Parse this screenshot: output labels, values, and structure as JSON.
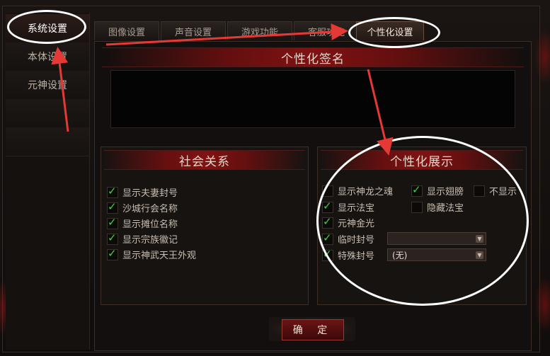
{
  "sidebar": {
    "items": [
      {
        "label": "系统设置",
        "active": true
      },
      {
        "label": "本体设置",
        "active": false
      },
      {
        "label": "元神设置",
        "active": false
      }
    ]
  },
  "tabs": [
    {
      "label": "图像设置",
      "active": false
    },
    {
      "label": "声音设置",
      "active": false
    },
    {
      "label": "游戏功能",
      "active": false
    },
    {
      "label": "客服功能",
      "active": false
    },
    {
      "label": "个性化设置",
      "active": true
    }
  ],
  "signature": {
    "title": "个性化签名",
    "value": ""
  },
  "social": {
    "title": "社会关系",
    "options": [
      {
        "label": "显示夫妻封号",
        "checked": true
      },
      {
        "label": "沙城行会名称",
        "checked": true
      },
      {
        "label": "显示摊位名称",
        "checked": true
      },
      {
        "label": "显示宗族徽记",
        "checked": true
      },
      {
        "label": "显示神武天王外观",
        "checked": true
      }
    ]
  },
  "display": {
    "title": "个性化展示",
    "show_dragon_soul": {
      "label": "显示神龙之魂",
      "checked": false
    },
    "show_wings": {
      "label": "显示翅膀",
      "checked": true
    },
    "hide_wings": {
      "label": "不显示",
      "checked": false
    },
    "show_treasure": {
      "label": "显示法宝",
      "checked": true
    },
    "hide_treasure": {
      "label": "隐藏法宝",
      "checked": false
    },
    "spirit_glow": {
      "label": "元神金光",
      "checked": true
    },
    "temp_title": {
      "label": "临时封号",
      "checked": true,
      "value": ""
    },
    "special_title": {
      "label": "特殊封号",
      "checked": true,
      "value": "(无)"
    }
  },
  "confirm_label": "确 定",
  "colors": {
    "check": "#3fd23a",
    "accent": "#8b1616",
    "annotation_arrow": "#e53935",
    "annotation_circle": "#ffffff"
  }
}
